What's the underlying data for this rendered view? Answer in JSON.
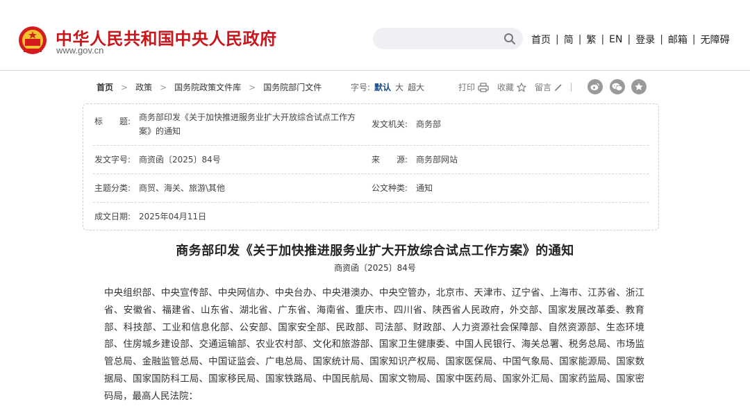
{
  "header": {
    "site_title": "中华人民共和国中央人民政府",
    "site_url": "www.gov.cn",
    "search": {
      "placeholder": ""
    },
    "nav": [
      "首页",
      "简",
      "繁",
      "EN",
      "登录",
      "邮箱",
      "无障碍"
    ],
    "brand_color": "#c8161d"
  },
  "breadcrumb": [
    "首页",
    "政策",
    "国务院政策文件库",
    "国务院部门文件"
  ],
  "font_size": {
    "label": "字号:",
    "options": [
      "默认",
      "大",
      "超大"
    ],
    "selected": "默认"
  },
  "tools": {
    "print": "打印",
    "favorite": "收藏",
    "comment": "留言"
  },
  "share_icons": [
    "weibo-icon",
    "wechat-icon",
    "star-share-icon"
  ],
  "info": {
    "title_label": "标　　题:",
    "title_value_1": "商务部印发《关于加快推进服务业扩大开放综合试点工作方",
    "title_value_2": "案》的通知",
    "issuer_label": "发文机关:",
    "issuer_value": "商务部",
    "doc_no_label": "发文字号:",
    "doc_no_value": "商资函〔2025〕84号",
    "source_label": "来　　源:",
    "source_value": "商务部网站",
    "topic_label": "主题分类:",
    "topic_value": "商贸、海关、旅游\\其他",
    "type_label": "公文种类:",
    "type_value": "通知",
    "date_label": "成文日期:",
    "date_value": "2025年04月11日"
  },
  "article": {
    "title": "商务部印发《关于加快推进服务业扩大开放综合试点工作方案》的通知",
    "doc_no": "商资函〔2025〕84号",
    "body": "中央组织部、中央宣传部、中央网信办、中央台办、中央港澳办、中央空管办，北京市、天津市、辽宁省、上海市、江苏省、浙江省、安徽省、福建省、山东省、湖北省、广东省、海南省、重庆市、四川省、陕西省人民政府，外交部、国家发展改革委、教育部、科技部、工业和信息化部、公安部、国家安全部、民政部、司法部、财政部、人力资源社会保障部、自然资源部、生态环境部、住房城乡建设部、交通运输部、农业农村部、文化和旅游部、国家卫生健康委、中国人民银行、海关总署、税务总局、市场监管总局、金融监管总局、中国证监会、广电总局、国家统计局、国家知识产权局、国家医保局、中国气象局、国家能源局、国家数据局、国家国防科工局、国家移民局、国家铁路局、中国民航局、国家文物局、国家中医药局、国家外汇局、国家药监局、国家密码局，最高人民法院："
  }
}
